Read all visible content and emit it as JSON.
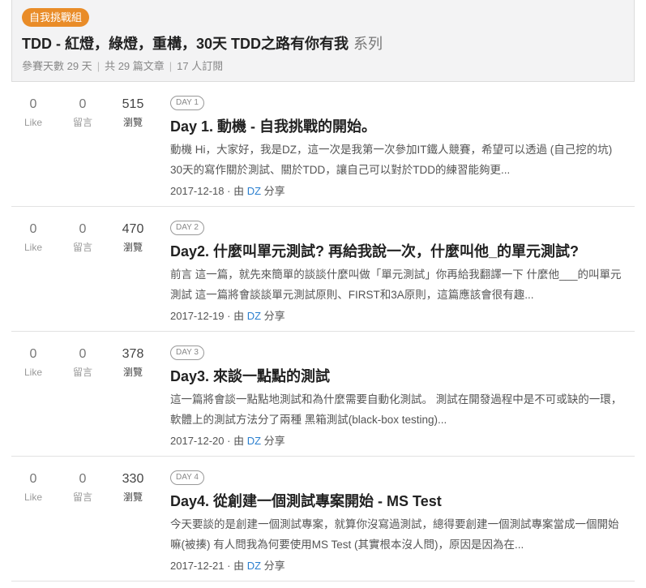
{
  "series": {
    "badge": "自我挑戰組",
    "title": "TDD - 紅燈，綠燈，重構，30天 TDD之路有你有我",
    "title_suffix": "系列",
    "days": "參賽天數 29 天",
    "articles": "共 29 篇文章",
    "subscribers": "17 人訂閱"
  },
  "labels": {
    "like": "Like",
    "comment": "留言",
    "views": "瀏覽",
    "by": "· 由",
    "share": "分享"
  },
  "articles": [
    {
      "likes": "0",
      "comments": "0",
      "views": "515",
      "tag": "DAY 1",
      "title": "Day 1. 動機 - 自我挑戰的開始。",
      "desc": "動機 Hi，大家好，我是DZ，這一次是我第一次參加IT鐵人競賽，希望可以透過 (自己挖的坑) 30天的寫作關於測試、關於TDD，讓自己可以對於TDD的練習能夠更...",
      "date": "2017-12-18",
      "author": "DZ"
    },
    {
      "likes": "0",
      "comments": "0",
      "views": "470",
      "tag": "DAY 2",
      "title": "Day2. 什麼叫單元測試? 再給我說一次，什麼叫他_的單元測試?",
      "desc": "前言 這一篇，就先來簡單的談談什麼叫做「單元測試」你再給我翻譯一下 什麼他___的叫單元測試 這一篇將會談談單元測試原則、FIRST和3A原則，這篇應該會很有趣...",
      "date": "2017-12-19",
      "author": "DZ"
    },
    {
      "likes": "0",
      "comments": "0",
      "views": "378",
      "tag": "DAY 3",
      "title": "Day3. 來談一點點的測試",
      "desc": "這一篇將會談一點點地測試和為什麼需要自動化測試。 測試在開發過程中是不可或缺的一環，軟體上的測試方法分了兩種 黑箱測試(black-box testing)...",
      "date": "2017-12-20",
      "author": "DZ"
    },
    {
      "likes": "0",
      "comments": "0",
      "views": "330",
      "tag": "DAY 4",
      "title": "Day4. 從創建一個測試專案開始 - MS Test",
      "desc": "今天要談的是創建一個測試專案，就算你沒寫過測試，總得要創建一個測試專案當成一個開始嘛(被揍) 有人問我為何要使用MS Test (其實根本沒人問)，原因是因為在...",
      "date": "2017-12-21",
      "author": "DZ"
    }
  ]
}
